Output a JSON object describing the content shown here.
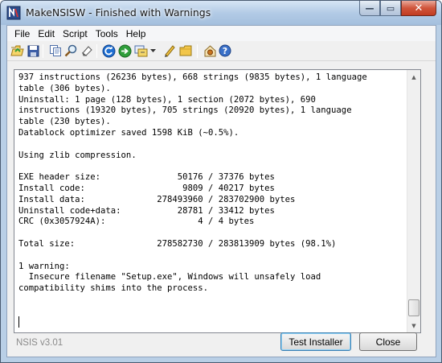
{
  "window": {
    "title": "MakeNSISW - Finished with Warnings",
    "minimize_glyph": "—",
    "maximize_glyph": "▭",
    "close_glyph": "✕"
  },
  "menu": {
    "items": [
      "File",
      "Edit",
      "Script",
      "Tools",
      "Help"
    ]
  },
  "toolbar": {
    "icons": [
      "open-script-icon",
      "save-icon",
      "copy-icon",
      "find-icon",
      "clear-log-icon",
      "recompile-icon",
      "test-icon",
      "compressor-icon",
      "dropdown-arrow-icon",
      "edit-script-icon",
      "browse-folder-icon",
      "settings-icon",
      "help-icon"
    ]
  },
  "log": {
    "lines": [
      "937 instructions (26236 bytes), 668 strings (9835 bytes), 1 language",
      "table (306 bytes).",
      "Uninstall: 1 page (128 bytes), 1 section (2072 bytes), 690",
      "instructions (19320 bytes), 705 strings (20920 bytes), 1 language",
      "table (230 bytes).",
      "Datablock optimizer saved 1598 KiB (~0.5%).",
      "",
      "Using zlib compression.",
      "",
      "EXE header size:               50176 / 37376 bytes",
      "Install code:                   9809 / 40217 bytes",
      "Install data:              278493960 / 283702900 bytes",
      "Uninstall code+data:           28781 / 33412 bytes",
      "CRC (0x3057924A):                  4 / 4 bytes",
      "",
      "Total size:                278582730 / 283813909 bytes (98.1%)",
      "",
      "1 warning:",
      "  Insecure filename \"Setup.exe\", Windows will unsafely load",
      "compatibility shims into the process."
    ],
    "scroll_position": 0.93
  },
  "footer": {
    "version_label": "NSIS v3.01",
    "test_button_label": "Test Installer",
    "close_button_label": "Close"
  },
  "colors": {
    "titlebar": "#b3cbe6",
    "close_button": "#c13c22",
    "recompile_icon": "#1f6fd1",
    "test_icon": "#2f9e3a"
  }
}
